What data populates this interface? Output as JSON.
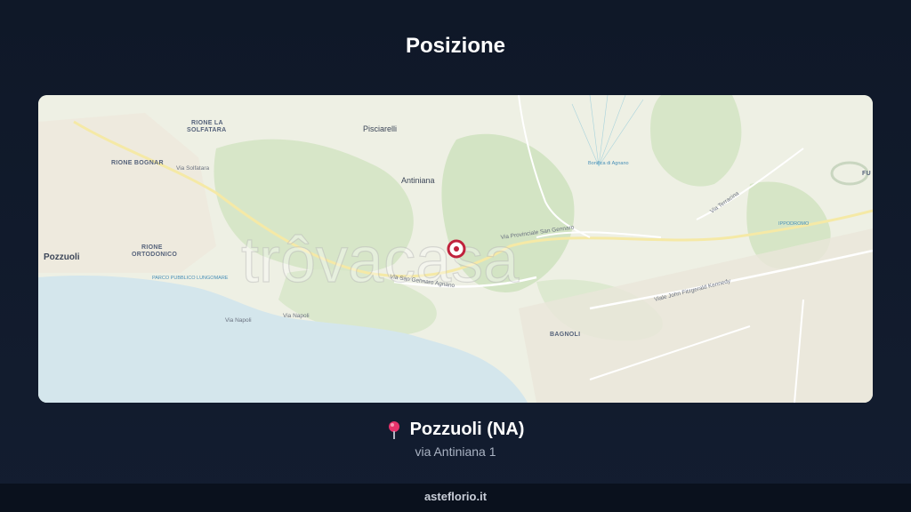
{
  "page": {
    "title": "Posizione"
  },
  "map": {
    "watermark": "trôvacasa",
    "labels": {
      "rione_la_solfatara_1": "RIONE LA",
      "rione_la_solfatara_2": "SOLFATARA",
      "rione_bognar": "RIONE BOGNAR",
      "rione_ortodonico_1": "RIONE",
      "rione_ortodonico_2": "ORTODONICO",
      "pozzuoli": "Pozzuoli",
      "pisciarelli": "Pisciarelli",
      "antiniana": "Antiniana",
      "bagnoli": "BAGNOLI",
      "rione_b": "RIONE B",
      "via_solfatara": "Via Solfatara",
      "via_san_gennaro_agnano": "Via San Gennaro Agnano",
      "via_napoli_1": "Via Napoli",
      "via_napoli_2": "Via Napoli",
      "via_provinciale": "Via Provinciale San Gennaro",
      "viale_kennedy": "Viale John Fitzgerald Kennedy",
      "via_terracina": "Via Terracina",
      "parco_pubblico": "PARCO PUBBLICO LUNGOMARE",
      "bonifica": "Bonifica di Agnano",
      "ippodromo": "IPPODROMO",
      "fu": "FU"
    }
  },
  "location": {
    "name": "Pozzuoli (NA)",
    "address": "via Antiniana 1",
    "pin_color": "#e6336b"
  },
  "footer": {
    "text": "asteflorio.it"
  }
}
